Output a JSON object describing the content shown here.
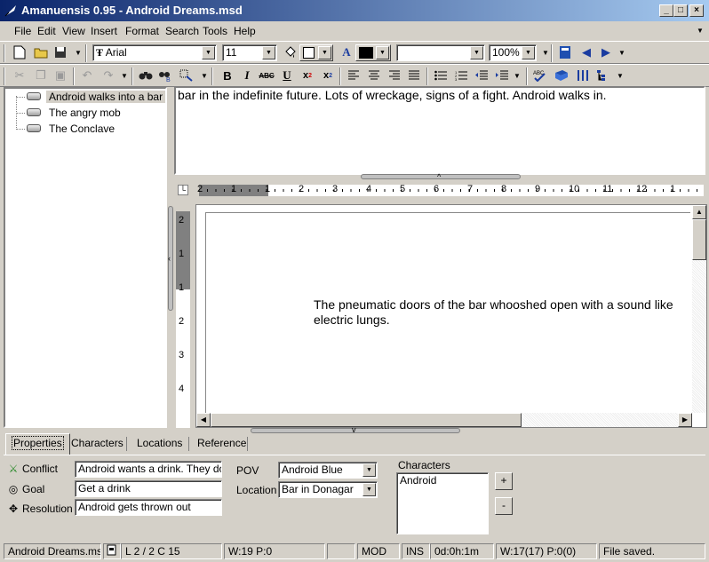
{
  "window": {
    "title": "Amanuensis 0.95 - Android Dreams.msd",
    "min_glyph": "_",
    "max_glyph": "□",
    "close_glyph": "×"
  },
  "menu": [
    "File",
    "Edit",
    "View",
    "Insert",
    "Format",
    "Search",
    "Tools",
    "Help"
  ],
  "toolbar": {
    "font_name": "Arial",
    "font_size": "11",
    "style_value": "",
    "zoom": "100%"
  },
  "tree": {
    "items": [
      "Android walks into a bar",
      "The angry mob",
      "The Conclave"
    ],
    "selected_index": 0
  },
  "synopsis": {
    "text": "bar in the indefinite future. Lots of wreckage, signs of a fight. Android walks in."
  },
  "ruler": {
    "h_numbers": [
      "2",
      "1",
      "1",
      "2",
      "3",
      "4",
      "5",
      "6",
      "7",
      "8",
      "9",
      "10",
      "11",
      "12",
      "1"
    ],
    "v_numbers": [
      "2",
      "1",
      "1",
      "2",
      "3",
      "4"
    ]
  },
  "document": {
    "text": "The pneumatic doors of the bar whooshed open with a sound like electric lungs."
  },
  "tabs": [
    {
      "label": "Properties",
      "active": true
    },
    {
      "label": "Characters",
      "active": false
    },
    {
      "label": "Locations",
      "active": false
    },
    {
      "label": "Reference",
      "active": false
    }
  ],
  "properties": {
    "conflict_label": "Conflict",
    "conflict_value": "Android wants a drink. They don't",
    "goal_label": "Goal",
    "goal_value": "Get a drink",
    "resolution_label": "Resolution",
    "resolution_value": "Android gets thrown out",
    "pov_label": "POV",
    "pov_value": "Android Blue",
    "location_label": "Location",
    "location_value": "Bar in Donagar",
    "characters_label": "Characters",
    "characters": [
      "Android"
    ],
    "add_label": "+",
    "remove_label": "-"
  },
  "status": {
    "file": "Android Dreams.msd",
    "position": "L 2 / 2  C 15",
    "words": "W:19  P:0",
    "mode": "MOD",
    "insert": "INS",
    "time": "0d:0h:1m",
    "totals": "W:17(17)  P:0(0)",
    "message": "File saved."
  }
}
